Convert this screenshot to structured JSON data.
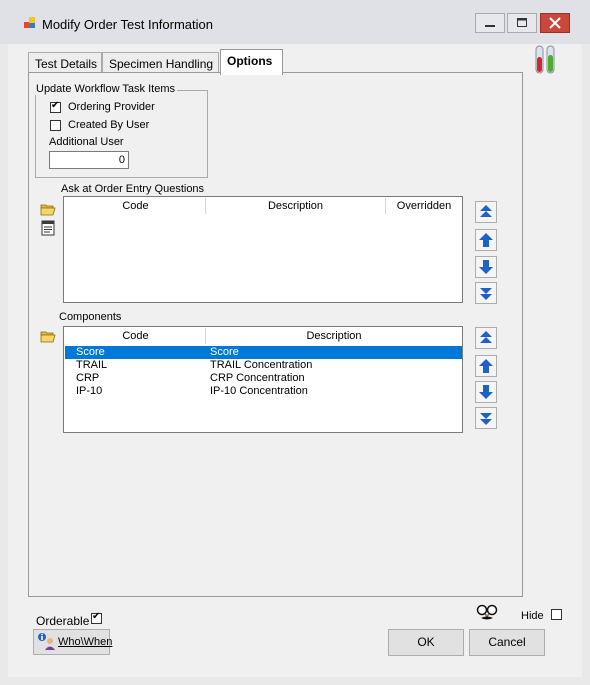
{
  "window": {
    "title": "Modify Order Test Information"
  },
  "tabs": [
    {
      "label": "Test Details"
    },
    {
      "label": "Specimen Handling"
    },
    {
      "label": "Options"
    }
  ],
  "workflow": {
    "legend": "Update Workflow Task Items",
    "ordering_provider_label": "Ordering Provider",
    "created_by_user_label": "Created By User",
    "additional_user_label": "Additional User",
    "additional_user_value": "0"
  },
  "questions": {
    "label": "Ask at Order Entry Questions",
    "columns": [
      "Code",
      "Description",
      "Overridden"
    ]
  },
  "components": {
    "label": "Components",
    "columns": [
      "Code",
      "Description"
    ],
    "rows": [
      {
        "code": "Score",
        "description": "Score"
      },
      {
        "code": "TRAIL",
        "description": "TRAIL Concentration"
      },
      {
        "code": "CRP",
        "description": "CRP Concentration"
      },
      {
        "code": "IP-10",
        "description": "IP-10 Concentration"
      }
    ]
  },
  "footer": {
    "orderable_label": "Orderable",
    "hide_label": "Hide",
    "whowhen_label": "Who\\When",
    "ok_label": "OK",
    "cancel_label": "Cancel"
  }
}
